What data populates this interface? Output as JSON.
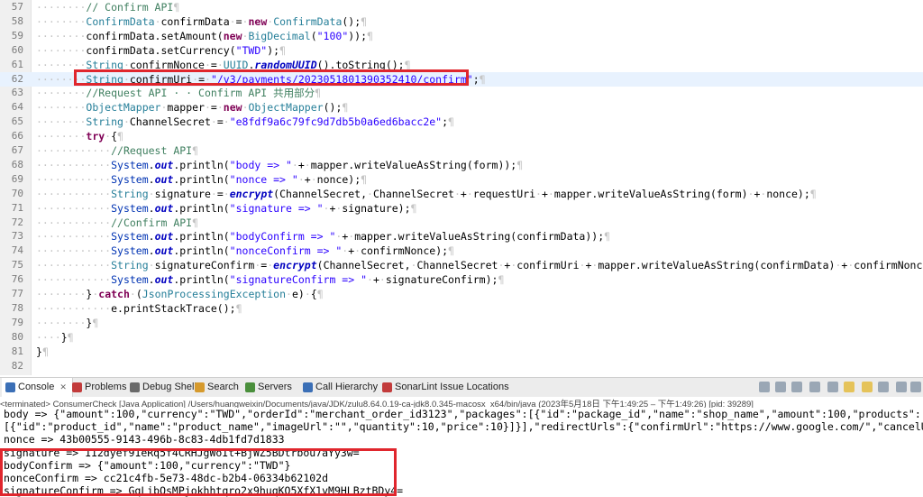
{
  "editor": {
    "lines": [
      {
        "n": "57",
        "segs": [
          [
            "ws",
            "········"
          ],
          [
            "cm",
            "// Confirm API"
          ],
          [
            "ws",
            "¶"
          ]
        ]
      },
      {
        "n": "58",
        "segs": [
          [
            "ws",
            "········"
          ],
          [
            "typ",
            "ConfirmData"
          ],
          [
            "ws",
            "·"
          ],
          [
            "",
            "confirmData"
          ],
          [
            "ws",
            "·"
          ],
          [
            "",
            "="
          ],
          [
            "ws",
            "·"
          ],
          [
            "kw",
            "new"
          ],
          [
            "ws",
            "·"
          ],
          [
            "typ",
            "ConfirmData"
          ],
          [
            "",
            "();"
          ],
          [
            "ws",
            "¶"
          ]
        ]
      },
      {
        "n": "59",
        "segs": [
          [
            "ws",
            "········"
          ],
          [
            "",
            "confirmData.setAmount("
          ],
          [
            "kw",
            "new"
          ],
          [
            "ws",
            "·"
          ],
          [
            "typ",
            "BigDecimal"
          ],
          [
            "",
            "("
          ],
          [
            "str",
            "\"100\""
          ],
          [
            "",
            "));"
          ],
          [
            "ws",
            "¶"
          ]
        ]
      },
      {
        "n": "60",
        "segs": [
          [
            "ws",
            "········"
          ],
          [
            "",
            "confirmData.setCurrency("
          ],
          [
            "str",
            "\"TWD\""
          ],
          [
            "",
            ");"
          ],
          [
            "ws",
            "¶"
          ]
        ]
      },
      {
        "n": "61",
        "segs": [
          [
            "ws",
            "········"
          ],
          [
            "typ",
            "String"
          ],
          [
            "ws",
            "·"
          ],
          [
            "",
            "confirmNonce"
          ],
          [
            "ws",
            "·"
          ],
          [
            "",
            "="
          ],
          [
            "ws",
            "·"
          ],
          [
            "typ",
            "UUID"
          ],
          [
            "",
            "."
          ],
          [
            "fld",
            "randomUUID"
          ],
          [
            "",
            "().toString();"
          ],
          [
            "ws",
            "¶"
          ]
        ]
      },
      {
        "n": "62",
        "hl": true,
        "segs": [
          [
            "ws",
            "········"
          ],
          [
            "typ",
            "String"
          ],
          [
            "ws",
            "·"
          ],
          [
            "",
            "confirmUri"
          ],
          [
            "ws",
            "·"
          ],
          [
            "",
            "="
          ],
          [
            "ws",
            "·"
          ],
          [
            "str",
            "\"/v3/payments/2023051801390352410/confirm\""
          ],
          [
            "",
            ";"
          ],
          [
            "ws",
            "¶"
          ]
        ]
      },
      {
        "n": "63",
        "segs": [
          [
            "ws",
            "········"
          ],
          [
            "cm",
            "//Request API · · Confirm API 共用部分"
          ],
          [
            "ws",
            "¶"
          ]
        ]
      },
      {
        "n": "64",
        "segs": [
          [
            "ws",
            "········"
          ],
          [
            "typ",
            "ObjectMapper"
          ],
          [
            "ws",
            "·"
          ],
          [
            "",
            "mapper"
          ],
          [
            "ws",
            "·"
          ],
          [
            "",
            "="
          ],
          [
            "ws",
            "·"
          ],
          [
            "kw",
            "new"
          ],
          [
            "ws",
            "·"
          ],
          [
            "typ",
            "ObjectMapper"
          ],
          [
            "",
            "();"
          ],
          [
            "ws",
            "¶"
          ]
        ]
      },
      {
        "n": "65",
        "segs": [
          [
            "ws",
            "········"
          ],
          [
            "typ",
            "String"
          ],
          [
            "ws",
            "·"
          ],
          [
            "",
            "ChannelSecret"
          ],
          [
            "ws",
            "·"
          ],
          [
            "",
            "="
          ],
          [
            "ws",
            "·"
          ],
          [
            "str",
            "\"e8fdf9a6c79fc9d7db5b0a6ed6bacc2e\""
          ],
          [
            "",
            ";"
          ],
          [
            "ws",
            "¶"
          ]
        ]
      },
      {
        "n": "66",
        "segs": [
          [
            "ws",
            "········"
          ],
          [
            "kw",
            "try"
          ],
          [
            "ws",
            "·"
          ],
          [
            "",
            "{"
          ],
          [
            "ws",
            "¶"
          ]
        ]
      },
      {
        "n": "67",
        "segs": [
          [
            "ws",
            "············"
          ],
          [
            "cm",
            "//Request API"
          ],
          [
            "ws",
            "¶"
          ]
        ]
      },
      {
        "n": "68",
        "segs": [
          [
            "ws",
            "············"
          ],
          [
            "ty",
            "System"
          ],
          [
            "",
            "."
          ],
          [
            "fld",
            "out"
          ],
          [
            "",
            ".println("
          ],
          [
            "str",
            "\"body => \""
          ],
          [
            "ws",
            "·"
          ],
          [
            "",
            "+"
          ],
          [
            "ws",
            "·"
          ],
          [
            "",
            "mapper.writeValueAsString(form));"
          ],
          [
            "ws",
            "¶"
          ]
        ]
      },
      {
        "n": "69",
        "segs": [
          [
            "ws",
            "············"
          ],
          [
            "ty",
            "System"
          ],
          [
            "",
            "."
          ],
          [
            "fld",
            "out"
          ],
          [
            "",
            ".println("
          ],
          [
            "str",
            "\"nonce => \""
          ],
          [
            "ws",
            "·"
          ],
          [
            "",
            "+"
          ],
          [
            "ws",
            "·"
          ],
          [
            "",
            "nonce);"
          ],
          [
            "ws",
            "¶"
          ]
        ]
      },
      {
        "n": "70",
        "segs": [
          [
            "ws",
            "············"
          ],
          [
            "typ",
            "String"
          ],
          [
            "ws",
            "·"
          ],
          [
            "",
            "signature"
          ],
          [
            "ws",
            "·"
          ],
          [
            "",
            "="
          ],
          [
            "ws",
            "·"
          ],
          [
            "fld",
            "encrypt"
          ],
          [
            "",
            "(ChannelSecret,"
          ],
          [
            "ws",
            "·"
          ],
          [
            "",
            "ChannelSecret"
          ],
          [
            "ws",
            "·"
          ],
          [
            "",
            "+"
          ],
          [
            "ws",
            "·"
          ],
          [
            "",
            "requestUri"
          ],
          [
            "ws",
            "·"
          ],
          [
            "",
            "+"
          ],
          [
            "ws",
            "·"
          ],
          [
            "",
            "mapper.writeValueAsString(form)"
          ],
          [
            "ws",
            "·"
          ],
          [
            "",
            "+"
          ],
          [
            "ws",
            "·"
          ],
          [
            "",
            "nonce);"
          ],
          [
            "ws",
            "¶"
          ]
        ]
      },
      {
        "n": "71",
        "segs": [
          [
            "ws",
            "············"
          ],
          [
            "ty",
            "System"
          ],
          [
            "",
            "."
          ],
          [
            "fld",
            "out"
          ],
          [
            "",
            ".println("
          ],
          [
            "str",
            "\"signature => \""
          ],
          [
            "ws",
            "·"
          ],
          [
            "",
            "+"
          ],
          [
            "ws",
            "·"
          ],
          [
            "",
            "signature);"
          ],
          [
            "ws",
            "¶"
          ]
        ]
      },
      {
        "n": "72",
        "segs": [
          [
            "ws",
            "············"
          ],
          [
            "cm",
            "//Confirm API"
          ],
          [
            "ws",
            "¶"
          ]
        ]
      },
      {
        "n": "73",
        "segs": [
          [
            "ws",
            "············"
          ],
          [
            "ty",
            "System"
          ],
          [
            "",
            "."
          ],
          [
            "fld",
            "out"
          ],
          [
            "",
            ".println("
          ],
          [
            "str",
            "\"bodyConfirm => \""
          ],
          [
            "ws",
            "·"
          ],
          [
            "",
            "+"
          ],
          [
            "ws",
            "·"
          ],
          [
            "",
            "mapper.writeValueAsString(confirmData));"
          ],
          [
            "ws",
            "¶"
          ]
        ]
      },
      {
        "n": "74",
        "segs": [
          [
            "ws",
            "············"
          ],
          [
            "ty",
            "System"
          ],
          [
            "",
            "."
          ],
          [
            "fld",
            "out"
          ],
          [
            "",
            ".println("
          ],
          [
            "str",
            "\"nonceConfirm => \""
          ],
          [
            "ws",
            "·"
          ],
          [
            "",
            "+"
          ],
          [
            "ws",
            "·"
          ],
          [
            "",
            "confirmNonce);"
          ],
          [
            "ws",
            "¶"
          ]
        ]
      },
      {
        "n": "75",
        "segs": [
          [
            "ws",
            "············"
          ],
          [
            "typ",
            "String"
          ],
          [
            "ws",
            "·"
          ],
          [
            "",
            "signatureConfirm"
          ],
          [
            "ws",
            "·"
          ],
          [
            "",
            "="
          ],
          [
            "ws",
            "·"
          ],
          [
            "fld",
            "encrypt"
          ],
          [
            "",
            "(ChannelSecret,"
          ],
          [
            "ws",
            "·"
          ],
          [
            "",
            "ChannelSecret"
          ],
          [
            "ws",
            "·"
          ],
          [
            "",
            "+"
          ],
          [
            "ws",
            "·"
          ],
          [
            "",
            "confirmUri"
          ],
          [
            "ws",
            "·"
          ],
          [
            "",
            "+"
          ],
          [
            "ws",
            "·"
          ],
          [
            "",
            "mapper.writeValueAsString(confirmData)"
          ],
          [
            "ws",
            "·"
          ],
          [
            "",
            "+"
          ],
          [
            "ws",
            "·"
          ],
          [
            "",
            "confirmNonce);"
          ],
          [
            "ws",
            "¶"
          ]
        ]
      },
      {
        "n": "76",
        "segs": [
          [
            "ws",
            "············"
          ],
          [
            "ty",
            "System"
          ],
          [
            "",
            "."
          ],
          [
            "fld",
            "out"
          ],
          [
            "",
            ".println("
          ],
          [
            "str",
            "\"signatureConfirm => \""
          ],
          [
            "ws",
            "·"
          ],
          [
            "",
            "+"
          ],
          [
            "ws",
            "·"
          ],
          [
            "",
            "signatureConfirm);"
          ],
          [
            "ws",
            "¶"
          ]
        ]
      },
      {
        "n": "77",
        "segs": [
          [
            "ws",
            "········"
          ],
          [
            "",
            "}"
          ],
          [
            "ws",
            "·"
          ],
          [
            "kw",
            "catch"
          ],
          [
            "ws",
            "·"
          ],
          [
            "",
            "("
          ],
          [
            "typ",
            "JsonProcessingException"
          ],
          [
            "ws",
            "·"
          ],
          [
            "",
            "e)"
          ],
          [
            "ws",
            "·"
          ],
          [
            "",
            "{"
          ],
          [
            "ws",
            "¶"
          ]
        ]
      },
      {
        "n": "78",
        "segs": [
          [
            "ws",
            "············"
          ],
          [
            "",
            "e.printStackTrace();"
          ],
          [
            "ws",
            "¶"
          ]
        ]
      },
      {
        "n": "79",
        "segs": [
          [
            "ws",
            "········"
          ],
          [
            "",
            "}"
          ],
          [
            "ws",
            "¶"
          ]
        ]
      },
      {
        "n": "80",
        "segs": [
          [
            "ws",
            "····"
          ],
          [
            "",
            "}"
          ],
          [
            "ws",
            "¶"
          ]
        ]
      },
      {
        "n": "81",
        "segs": [
          [
            "",
            "}"
          ],
          [
            "ws",
            "¶"
          ]
        ]
      },
      {
        "n": "82",
        "segs": []
      }
    ]
  },
  "tabs": {
    "items": [
      {
        "label": "Console",
        "icon": "console-icon",
        "color": "#3b6fb6",
        "active": true,
        "close": "✕"
      },
      {
        "label": "Problems",
        "icon": "problems-icon",
        "color": "#c23b3b"
      },
      {
        "label": "Debug Shell",
        "icon": "debug-shell-icon",
        "color": "#6a6a6a"
      },
      {
        "label": "Search",
        "icon": "search-icon",
        "color": "#d69a2d"
      },
      {
        "label": "Servers",
        "icon": "servers-icon",
        "color": "#4a8f3c"
      },
      {
        "label": "Call Hierarchy",
        "icon": "call-hierarchy-icon",
        "color": "#3b6fb6"
      },
      {
        "label": "SonarLint Issue Locations",
        "icon": "sonarlint-icon",
        "color": "#c23b3b"
      }
    ]
  },
  "status": {
    "text": "<terminated> ConsumerCheck [Java Application] /Users/huangweixin/Documents/java/JDK/zulu8.64.0.19-ca-jdk8.0.345-macosx_x64/bin/java  (2023年5月18日 下午1:49:25 – 下午1:49:26) [pid: 39289]"
  },
  "console": {
    "lines": [
      "body => {\"amount\":100,\"currency\":\"TWD\",\"orderId\":\"merchant_order_id3123\",\"packages\":[{\"id\":\"package_id\",\"name\":\"shop_name\",\"amount\":100,\"products\":",
      "[{\"id\":\"product_id\",\"name\":\"product_name\",\"imageUrl\":\"\",\"quantity\":10,\"price\":10}]}],\"redirectUrls\":{\"confirmUrl\":\"https://www.google.com/\",\"cancelUrl\"",
      "nonce => 43b00555-9143-496b-8c83-4db1fd7d1833",
      "signature => 112dyef91eRq5f4CRHJgWoIt+BjWZ5BDtrbou7aYy3w=",
      "bodyConfirm => {\"amount\":100,\"currency\":\"TWD\"}",
      "nonceConfirm => cc21c4fb-5e73-48dc-b2b4-06334b62102d",
      "signatureConfirm => GqLibOsMPjokhhtqro2x9huqKO5XfX1vM9HLBztBDy4="
    ]
  }
}
